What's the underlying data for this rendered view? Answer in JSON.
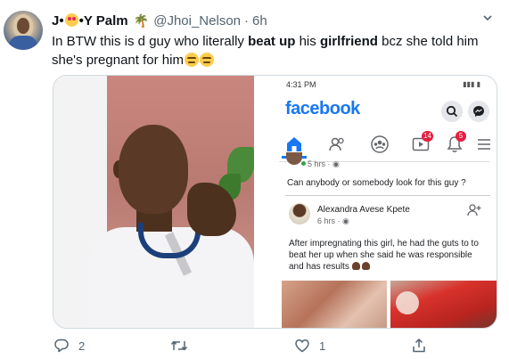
{
  "tweet": {
    "display_name_prefix": "J•",
    "display_name_mid": "•Y Palm",
    "handle": "@Jhoi_Nelson",
    "separator": "·",
    "time": "6h",
    "text_part1": "In BTW this is d guy who literally ",
    "text_bold1": "beat up",
    "text_part2": " his ",
    "text_bold2": "girlfriend",
    "text_part3": " bcz she told him she's pregnant for him"
  },
  "facebook_screenshot": {
    "status_time": "4:31 PM",
    "logo": "facebook",
    "watch_badge": "14",
    "notif_badge": "5",
    "post1_time": "5 hrs · ",
    "post1_text": "Can anybody or somebody look for this guy ?",
    "post2_author": "Alexandra Avese Kpete",
    "post2_time": "6 hrs · ",
    "post2_text": "After impregnating this girl, he had the guts to to beat her up when she said he was responsible and has results"
  },
  "actions": {
    "reply_count": "2",
    "retweet_count": "",
    "like_count": "1"
  },
  "colors": {
    "facebook_blue": "#1877f2",
    "twitter_gray": "#536471",
    "badge_red": "#e41e3f"
  },
  "icons": [
    "chevron-down-icon",
    "palm-tree-icon",
    "smiling-heart-eyes-icon",
    "unamused-face-icon",
    "search-icon",
    "messenger-icon",
    "home-icon",
    "friends-icon",
    "groups-icon",
    "watch-icon",
    "bell-icon",
    "menu-icon",
    "globe-icon",
    "add-friend-icon",
    "reply-icon",
    "retweet-icon",
    "like-icon",
    "share-icon"
  ]
}
